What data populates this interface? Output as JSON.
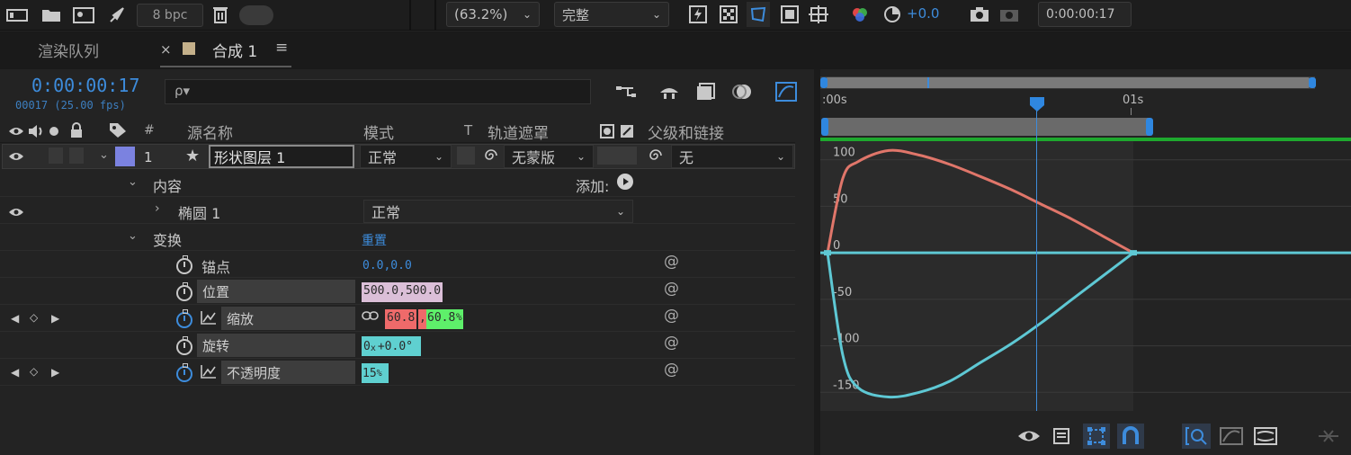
{
  "toolbar": {
    "bpc": "8 bpc",
    "zoom": "(63.2%)",
    "quality": "完整",
    "exposure": "+0.0",
    "timecode": "0:00:00:17"
  },
  "tabs": {
    "render_queue": "渲染队列",
    "comp_close": "×",
    "comp_name": "合成 1",
    "menu": "≡"
  },
  "timeline": {
    "current_time": "0:00:00:17",
    "frame_info": "00017 (25.00 fps)",
    "search_placeholder": "ρ▾"
  },
  "columns": {
    "hash": "#",
    "source_name": "源名称",
    "mode": "模式",
    "t": "T",
    "track_matte": "轨道遮罩",
    "parent": "父级和链接"
  },
  "layer": {
    "index": "1",
    "name": "形状图层 1",
    "mode": "正常",
    "matte": "无蒙版",
    "parent": "无",
    "label_color": "#7b82e0"
  },
  "properties": {
    "contents": "内容",
    "add_label": "添加:",
    "ellipse": "椭圆 1",
    "ellipse_mode": "正常",
    "transform": "变换",
    "reset": "重置",
    "anchor_label": "锚点",
    "anchor_value": "0.0,0.0",
    "position_label": "位置",
    "position_value": "500.0,500.0",
    "scale_label": "缩放",
    "scale_x": "60.8",
    "scale_sep": ",",
    "scale_y": "60.8",
    "scale_unit": "%",
    "rotation_label": "旋转",
    "rotation_turns": "0",
    "rotation_x": "x",
    "rotation_value": "+0.0",
    "rotation_unit": "°",
    "opacity_label": "不透明度",
    "opacity_value": "15",
    "opacity_unit": "%"
  },
  "ruler": {
    "start": ":00s",
    "end": "01s"
  },
  "chart_data": {
    "type": "line",
    "y_ticks": [
      100,
      50,
      0,
      -50,
      -100,
      -150
    ],
    "series": [
      {
        "color": "#e0766a",
        "x": [
          0,
          0.05,
          0.1,
          0.2,
          0.3,
          0.4,
          0.5,
          0.6,
          0.7,
          0.8,
          0.9,
          1.0
        ],
        "values": [
          0,
          80,
          98,
          110,
          105,
          95,
          82,
          68,
          52,
          36,
          18,
          0
        ]
      },
      {
        "color": "#5ec8d4",
        "x": [
          0,
          0.05,
          0.1,
          0.2,
          0.3,
          0.4,
          0.5,
          0.6,
          0.7,
          0.8,
          0.9,
          1.0
        ],
        "values": [
          0,
          -110,
          -145,
          -155,
          -150,
          -138,
          -118,
          -98,
          -75,
          -50,
          -25,
          0
        ]
      }
    ],
    "ylim": [
      -170,
      120
    ],
    "current_time_fraction": 0.69
  }
}
